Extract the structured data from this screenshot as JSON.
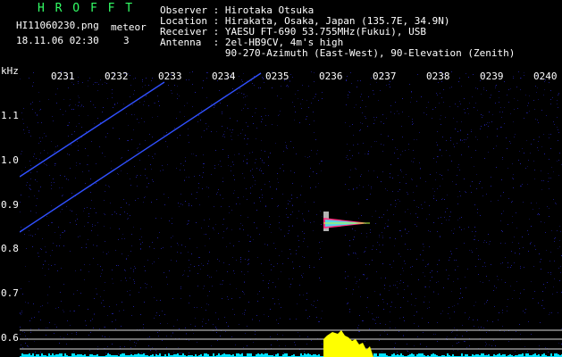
{
  "header": {
    "app_title": "H R O F F T",
    "file_name": "HI11060230.png",
    "timestamp": "18.11.06 02:30",
    "meteor_label": "meteor",
    "meteor_count": "3"
  },
  "info": {
    "observer_label": "Observer : Hirotaka Otsuka",
    "location_label": "Location : Hirakata, Osaka, Japan (135.7E, 34.9N)",
    "receiver_label": "Receiver : YAESU FT-690 53.755MHz(Fukui), USB",
    "antenna_label": "Antenna  : 2el-HB9CV, 4m's high",
    "antenna_detail": "           90-270-Azimuth (East-West), 90-Elevation (Zenith)"
  },
  "axis": {
    "unit": "kHz",
    "y_ticks": [
      "1.1",
      "1.0",
      "0.9",
      "0.8",
      "0.7",
      "0.6"
    ],
    "x_ticks": [
      "0231",
      "0232",
      "0233",
      "0234",
      "0235",
      "0236",
      "0237",
      "0238",
      "0239",
      "0240"
    ]
  },
  "colors": {
    "background": "#000000",
    "noise": "#2020a0",
    "trail": "#3050ff",
    "echo": "#ff3080",
    "histogram": "#ffff00",
    "baseline": "#00e0ff",
    "text": "#ffffff",
    "title": "#33ff66"
  }
}
